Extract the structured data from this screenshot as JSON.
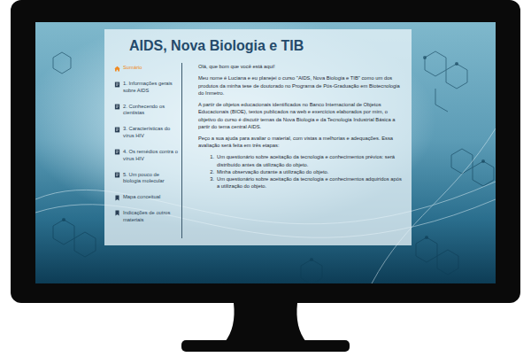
{
  "page": {
    "title": "AIDS, Nova Biologia e TIB"
  },
  "sidebar": {
    "items": [
      {
        "label": "Sumário",
        "kind": "home",
        "selected": true
      },
      {
        "label": "1. Informações gerais sobre AIDS",
        "kind": "chapter",
        "selected": false
      },
      {
        "label": "2. Conhecendo os cientistas",
        "kind": "chapter",
        "selected": false
      },
      {
        "label": "3. Características do vírus HIV",
        "kind": "chapter",
        "selected": false
      },
      {
        "label": "4. Os remédios contra o vírus HIV",
        "kind": "chapter",
        "selected": false
      },
      {
        "label": "5. Um pouco de biologia molecular",
        "kind": "chapter",
        "selected": false
      },
      {
        "label": "Mapa conceitual",
        "kind": "bookmark",
        "selected": false
      },
      {
        "label": "Indicações de outros materiais",
        "kind": "bookmark",
        "selected": false
      }
    ]
  },
  "content": {
    "greeting": "Olá, que bom que você está aqui!",
    "paragraphs": [
      "Meu nome é Luciana e eu planejei o curso \"AIDS, Nova Biologia e TIB\" como um dos produtos da minha tese de doutorado no Programa de Pós-Graduação em Biotecnologia do Inmetro.",
      "A partir de objetos educacionais identificados no Banco Internacional de Objetos Educacionais (BIOE), textos publicados na web e exercícios elaborados por mim, o objetivo do curso é discutir temas da Nova Biologia e da Tecnologia Industrial Básica a partir do tema central AIDS.",
      "Peço a sua ajuda para avaliar o material, com vistas a melhorias e adequações. Essa avaliação será feita em três etapas:"
    ],
    "steps": [
      {
        "number": "1.",
        "text": "Um questionário sobre aceitação da tecnologia e conhecimentos prévios: será distribuído antes da utilização do objeto."
      },
      {
        "number": "2.",
        "text": "Minha observação durante a utilização do objeto."
      },
      {
        "number": "3.",
        "text": "Um questionário sobre aceitação da tecnologia e conhecimentos adquiridos após a utilização do objeto."
      }
    ]
  }
}
